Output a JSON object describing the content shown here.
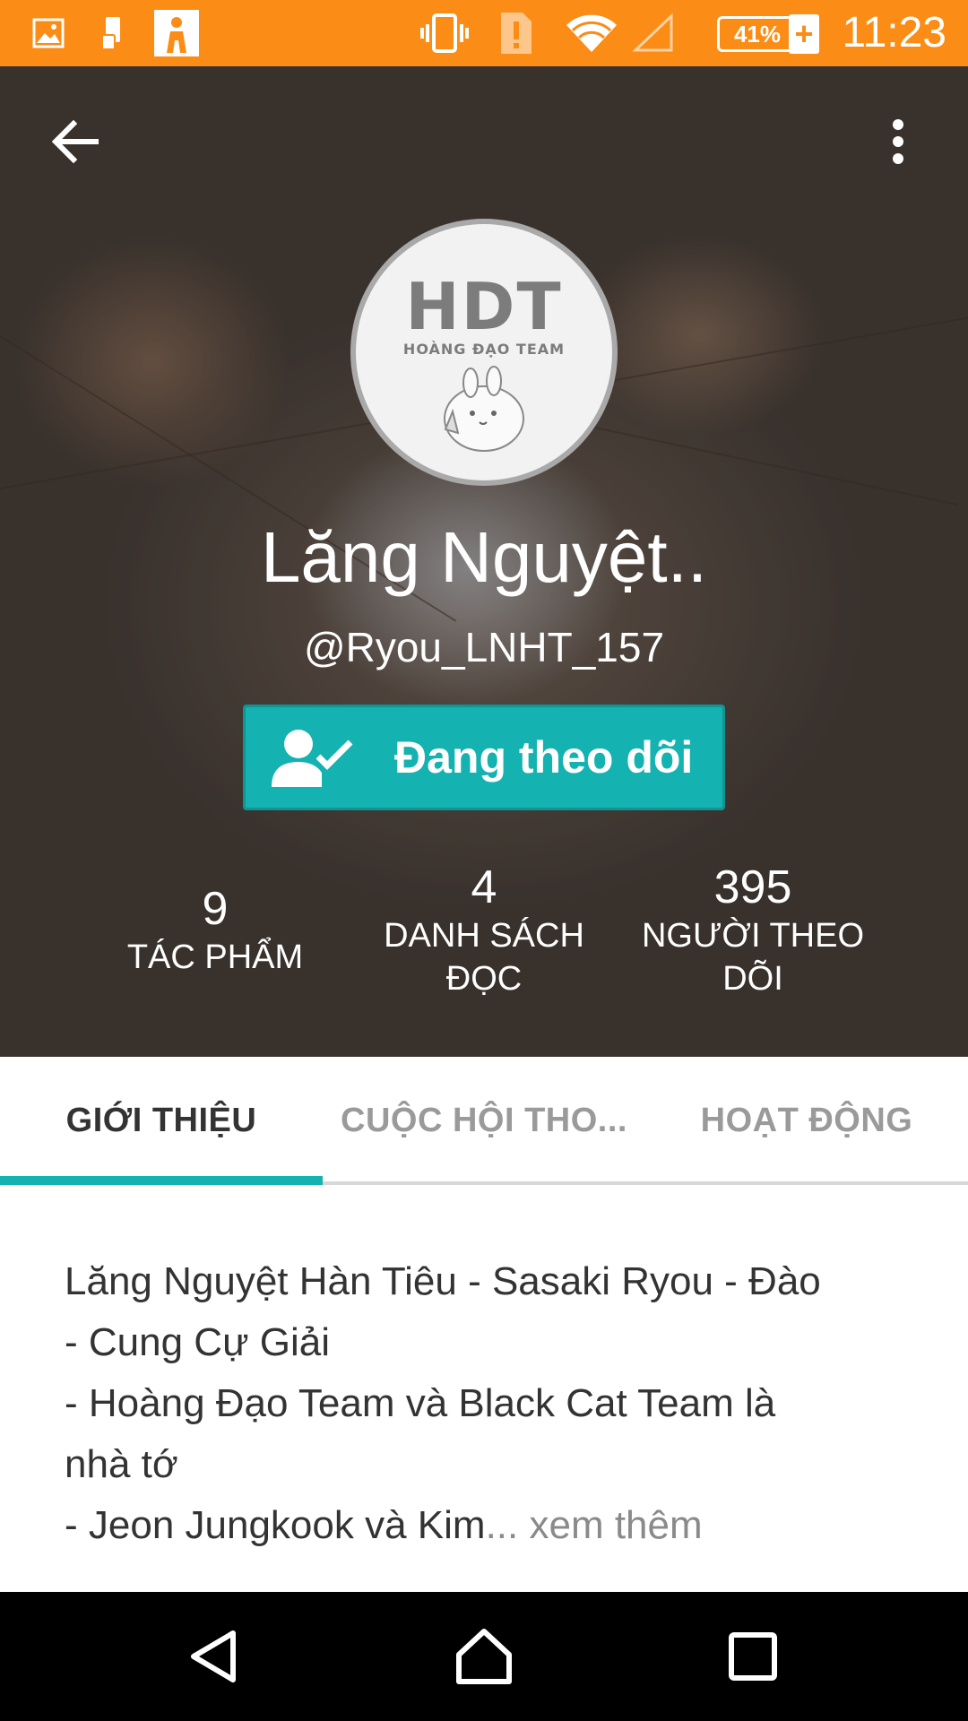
{
  "status_bar": {
    "time": "11:23",
    "battery": "41%",
    "icons": [
      "image-icon",
      "phone-icon",
      "app-icon",
      "vibrate-icon",
      "sim-alert-icon",
      "wifi-icon",
      "signal-icon",
      "battery-icon",
      "charging-icon"
    ],
    "background": "#fb8c16"
  },
  "header": {
    "back_icon": "arrow-left-icon",
    "more_icon": "more-vertical-icon"
  },
  "profile": {
    "avatar_title": "HDT",
    "avatar_subtitle": "HOÀNG ĐẠO TEAM",
    "name": "Lăng Nguyệt..",
    "handle": "@Ryou_LNHT_157",
    "follow_button": "Đang theo dõi",
    "accent": "#14b2b0"
  },
  "stats": [
    {
      "value": "9",
      "label_line1": "TÁC PHẨM",
      "label_line2": ""
    },
    {
      "value": "4",
      "label_line1": "DANH SÁCH",
      "label_line2": "ĐỌC"
    },
    {
      "value": "395",
      "label_line1": "NGƯỜI THEO",
      "label_line2": "DÕI"
    }
  ],
  "tabs": [
    {
      "label": "GIỚI THIỆU",
      "active": true
    },
    {
      "label": "CUỘC HỘI THO...",
      "active": false
    },
    {
      "label": "HOẠT ĐỘNG",
      "active": false
    }
  ],
  "about": {
    "lines": [
      "Lăng Nguyệt Hàn Tiêu - Sasaki Ryou - Đào",
      "- Cung Cự Giải",
      "- Hoàng Đạo Team và Black Cat Team là",
      "nhà tớ",
      "- Jeon Jungkook và Kim"
    ],
    "ellipsis": "...",
    "see_more": " xem thêm"
  },
  "nav_bar": {
    "icons": [
      "back-triangle-icon",
      "home-icon",
      "recents-icon"
    ]
  }
}
